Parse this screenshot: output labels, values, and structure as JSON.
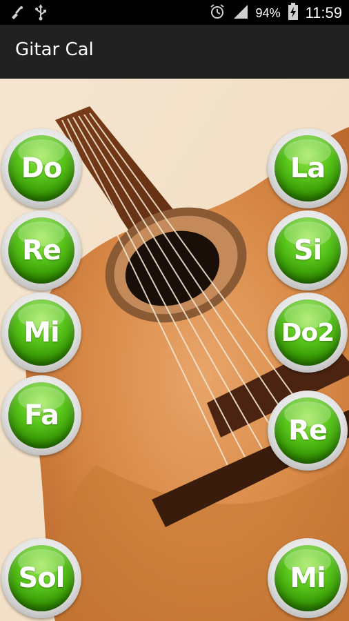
{
  "status_bar": {
    "icons": [
      "broom-icon",
      "usb-icon",
      "alarm-icon",
      "signal-icon",
      "battery-charging-icon"
    ],
    "battery_percent": "94%",
    "time": "11:59"
  },
  "app_bar": {
    "title": "Gitar Cal"
  },
  "notes": {
    "left": [
      "Do",
      "Re",
      "Mi",
      "Fa",
      "Sol"
    ],
    "right": [
      "La",
      "Si",
      "Do2",
      "Re",
      "Mi"
    ]
  },
  "colors": {
    "status_bar_bg": "#000000",
    "app_bar_bg": "#212121",
    "button_green": "#3a9e0a",
    "button_ring": "#dcdcdc"
  }
}
